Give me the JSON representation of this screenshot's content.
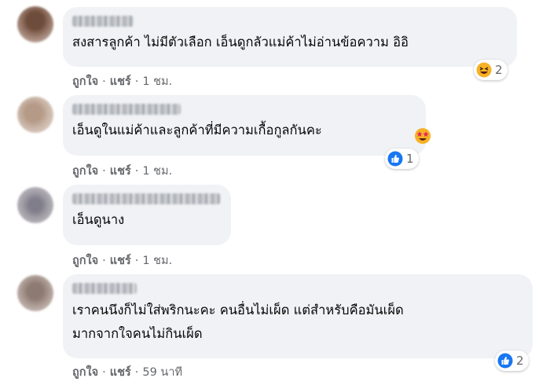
{
  "comments": [
    {
      "text": [
        "สงสารลูกค้า  ไม่มีตัวเลือก  เอ็นดูกลัวแม่ค้าไม่อ่านข้อความ  อิอิ"
      ],
      "actions": {
        "like": "ถูกใจ",
        "reply": "แชร์",
        "time": "1 ชม."
      },
      "reaction": {
        "icon": "haha-emoji-icon",
        "count": "2"
      }
    },
    {
      "text": [
        "เอ็นดูในแม่ค้าและลูกค้าที่มีความเกื้อกูลกันคะ"
      ],
      "actions": {
        "like": "ถูกใจ",
        "reply": "แชร์",
        "time": "1 ชม."
      },
      "reaction": {
        "icon": "like-icon",
        "count": "1"
      },
      "inline_emoji": "star-struck-emoji-icon"
    },
    {
      "text": [
        "เอ็นดูนาง"
      ],
      "actions": {
        "like": "ถูกใจ",
        "reply": "แชร์",
        "time": "1 ชม."
      }
    },
    {
      "text": [
        "เราคนนึงก็ไม่ใส่พริกนะคะ  คนอื่นไม่เผ็ด  แต่สำหรับคือมันเผ็ด",
        "มากจากใจคนไม่กินเผ็ด"
      ],
      "actions": {
        "like": "ถูกใจ",
        "reply": "แชร์",
        "time": "59 นาที"
      },
      "reaction": {
        "icon": "like-icon",
        "count": "2"
      }
    }
  ],
  "colors": {
    "bubble": "#f0f2f5",
    "meta": "#65676b",
    "like_blue": "#1877f2",
    "haha_yellow": "#f7b125"
  }
}
